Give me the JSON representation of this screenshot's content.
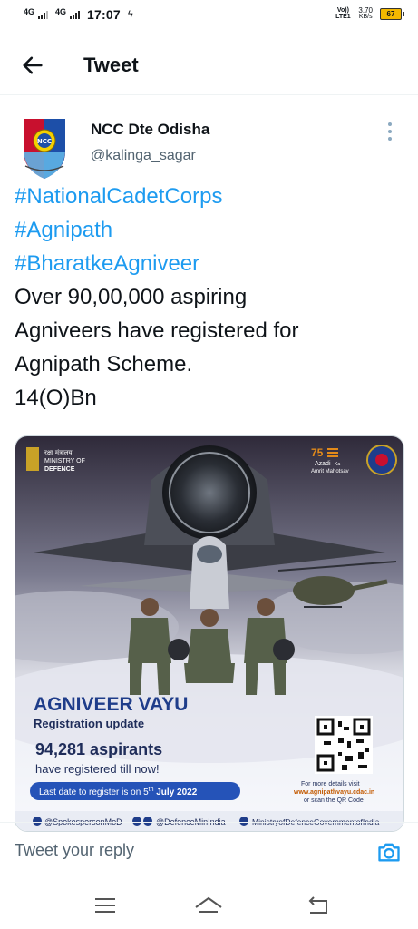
{
  "status_bar": {
    "network_1": "4G",
    "network_2": "4G",
    "time": "17:07",
    "volte": "Vo)) LTE1",
    "speed_value": "3.70",
    "speed_unit": "KB/s",
    "battery": "67"
  },
  "header": {
    "title": "Tweet"
  },
  "tweet": {
    "display_name": "NCC Dte Odisha",
    "handle": "@kalinga_sagar",
    "hashtags": [
      "#NationalCadetCorps",
      "#Agnipath",
      "#BharatkeAgniveer"
    ],
    "body_lines": [
      "Over 90,00,000 aspiring",
      "Agniveers have registered for",
      "Agnipath Scheme.",
      "14(O)Bn"
    ]
  },
  "poster": {
    "ministry_hindi": "रक्षा मंत्रालय",
    "ministry_line1": "MINISTRY OF",
    "ministry_line2": "DEFENCE",
    "azadi_75": "75",
    "azadi_line1": "Azadi",
    "azadi_line2": "Ka",
    "azadi_line3": "Amrit Mahotsav",
    "heading": "AGNIVEER VAYU",
    "subheading": "Registration update",
    "count": "94,281 aspirants",
    "count_sub": "have registered till now!",
    "deadline_prefix": "Last date to register is on 5",
    "deadline_sup": "th",
    "deadline_suffix": " July 2022",
    "details_line1": "For more details visit",
    "details_url": "www.agnipathvayu.cdac.in",
    "details_line3": "or scan the QR Code",
    "social_1": "@SpokespersonMoD",
    "social_2": "@DefenceMinIndia",
    "social_3": "MinistryofDefenceGovernmentofIndia"
  },
  "reply": {
    "placeholder": "Tweet your reply"
  },
  "colors": {
    "link": "#1d9bf0",
    "poster_blue": "#1f3d8a",
    "poster_pill": "#2553b8"
  }
}
